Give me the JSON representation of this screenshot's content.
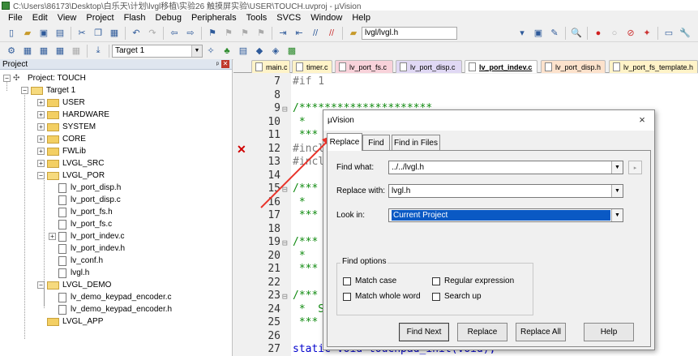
{
  "window": {
    "title": "C:\\Users\\86173\\Desktop\\白乐天\\计划\\lvgl移植\\实验26 触摸屏实验\\USER\\TOUCH.uvproj - µVision"
  },
  "menu": [
    "File",
    "Edit",
    "View",
    "Project",
    "Flash",
    "Debug",
    "Peripherals",
    "Tools",
    "SVCS",
    "Window",
    "Help"
  ],
  "toolbar1": {
    "find_combo": "lvgl/lvgl.h"
  },
  "toolbar2": {
    "target_combo": "Target 1"
  },
  "project_panel": {
    "title": "Project",
    "root": "Project: TOUCH",
    "target": "Target 1",
    "groups": [
      "USER",
      "HARDWARE",
      "SYSTEM",
      "CORE",
      "FWLib",
      "LVGL_SRC",
      "LVGL_POR"
    ],
    "por_files": [
      "lv_port_disp.h",
      "lv_port_disp.c",
      "lv_port_fs.h",
      "lv_port_fs.c",
      "lv_port_indev.c",
      "lv_port_indev.h",
      "lv_conf.h",
      "lvgl.h"
    ],
    "demo_group": "LVGL_DEMO",
    "demo_files": [
      "lv_demo_keypad_encoder.c",
      "lv_demo_keypad_encoder.h"
    ],
    "app_group": "LVGL_APP"
  },
  "editor_tabs": [
    "main.c",
    "timer.c",
    "lv_port_fs.c",
    "lv_port_disp.c",
    "lv_port_indev.c",
    "lv_port_disp.h",
    "lv_port_fs_template.h"
  ],
  "editor_lines": [
    {
      "n": "7",
      "text": "#if 1"
    },
    {
      "n": "8",
      "text": ""
    },
    {
      "n": "9",
      "text": "/*********************"
    },
    {
      "n": "10",
      "text": " *"
    },
    {
      "n": "11",
      "text": " ***"
    },
    {
      "n": "12",
      "text": "#incl"
    },
    {
      "n": "13",
      "text": "#incl"
    },
    {
      "n": "14",
      "text": ""
    },
    {
      "n": "15",
      "text": "/***"
    },
    {
      "n": "16",
      "text": " *"
    },
    {
      "n": "17",
      "text": " ***"
    },
    {
      "n": "18",
      "text": ""
    },
    {
      "n": "19",
      "text": "/***"
    },
    {
      "n": "20",
      "text": " *"
    },
    {
      "n": "21",
      "text": " ***"
    },
    {
      "n": "22",
      "text": ""
    },
    {
      "n": "23",
      "text": "/***"
    },
    {
      "n": "24",
      "text": " *  S"
    },
    {
      "n": "25",
      "text": " ***"
    },
    {
      "n": "26",
      "text": ""
    },
    {
      "n": "27",
      "text": "static void touchpad_init(void);"
    }
  ],
  "dialog": {
    "title": "µVision",
    "tabs": [
      "Replace",
      "Find",
      "Find in Files"
    ],
    "find_what_label": "Find what:",
    "find_what_value": "../../lvgl.h",
    "replace_with_label": "Replace with:",
    "replace_with_value": "lvgl.h",
    "look_in_label": "Look in:",
    "look_in_value": "Current Project",
    "options_title": "Find options",
    "options": [
      "Match case",
      "Match whole word",
      "Regular expression",
      "Search up"
    ],
    "buttons": {
      "find_next": "Find Next",
      "replace": "Replace",
      "replace_all": "Replace All",
      "help": "Help"
    },
    "close": "×"
  },
  "colors": {
    "annotation_arrow": "#e8332a",
    "error_mark": "#d00000",
    "selection": "#0a59c4"
  }
}
